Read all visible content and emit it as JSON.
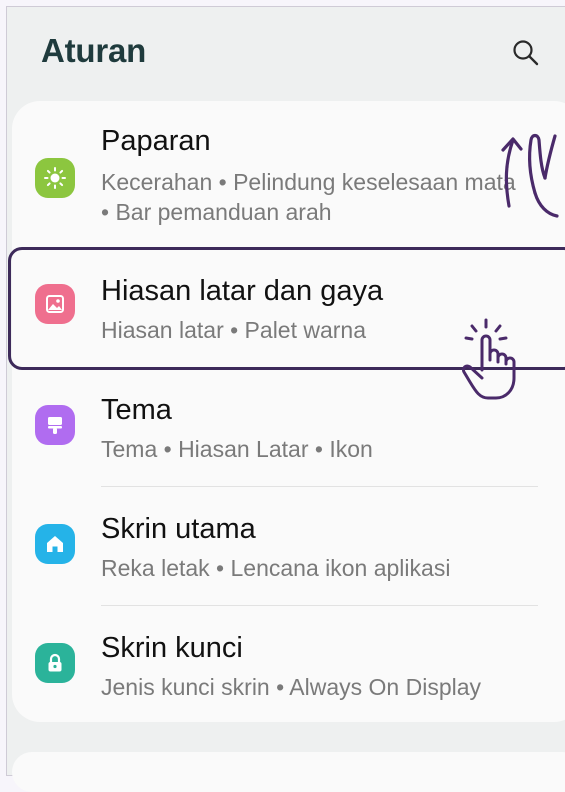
{
  "header": {
    "title": "Aturan",
    "search_icon": "search-icon"
  },
  "settings": [
    {
      "title": "Paparan",
      "subtitle": "Kecerahan  •  Pelindung keselesaan mata  •  Bar pemanduan arah",
      "icon": "sun-icon",
      "color": "#8cc63f"
    },
    {
      "title": "Hiasan latar dan gaya",
      "subtitle": "Hiasan latar  •  Palet warna",
      "icon": "image-icon",
      "color": "#ef6f8e"
    },
    {
      "title": "Tema",
      "subtitle": "Tema  •  Hiasan Latar  •  Ikon",
      "icon": "paint-brush-icon",
      "color": "#b06cf0"
    },
    {
      "title": "Skrin utama",
      "subtitle": "Reka letak  •  Lencana ikon aplikasi",
      "icon": "home-icon",
      "color": "#25b3e8"
    },
    {
      "title": "Skrin kunci",
      "subtitle": "Jenis kunci skrin  •  Always On Display",
      "icon": "lock-icon",
      "color": "#2bb39a"
    }
  ],
  "annotations": {
    "highlight_color": "#3d2a5a",
    "gestures": [
      "swipe-up-gesture-icon",
      "tap-gesture-icon"
    ]
  }
}
